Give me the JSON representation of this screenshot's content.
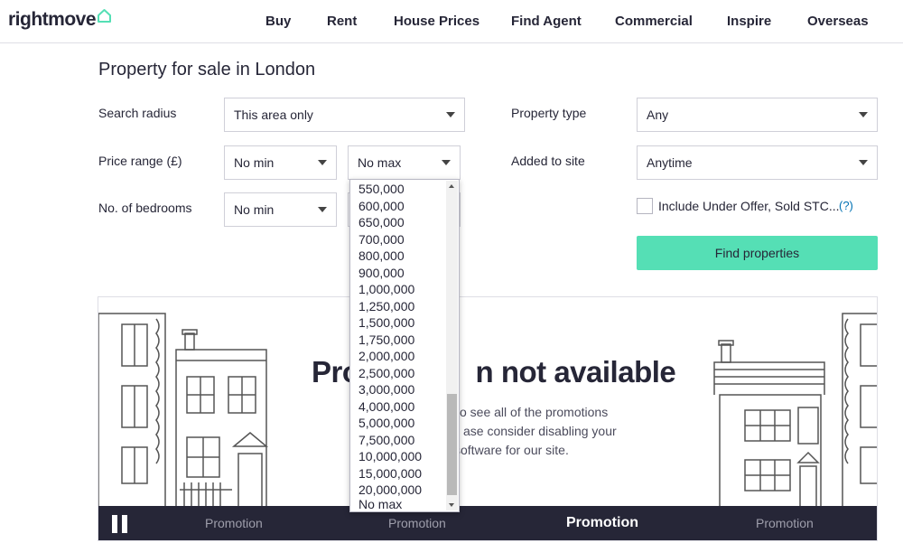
{
  "header": {
    "logo_text": "rightmove",
    "nav": [
      "Buy",
      "Rent",
      "House Prices",
      "Find Agent",
      "Commercial",
      "Inspire",
      "Overseas"
    ]
  },
  "page_title": "Property for sale in London",
  "form": {
    "search_radius": {
      "label": "Search radius",
      "value": "This area only"
    },
    "price_range": {
      "label": "Price range (£)",
      "min": "No min",
      "max": "No max"
    },
    "bedrooms": {
      "label": "No. of bedrooms",
      "min": "No min"
    },
    "property_type": {
      "label": "Property type",
      "value": "Any"
    },
    "added_to_site": {
      "label": "Added to site",
      "value": "Anytime"
    },
    "include_under_offer": {
      "label": "Include Under Offer, Sold STC...",
      "help": "(?)"
    },
    "find_button": "Find properties"
  },
  "max_price_dropdown": {
    "options": [
      "550,000",
      "600,000",
      "650,000",
      "700,000",
      "800,000",
      "900,000",
      "1,000,000",
      "1,250,000",
      "1,500,000",
      "1,750,000",
      "2,000,000",
      "2,500,000",
      "3,000,000",
      "4,000,000",
      "5,000,000",
      "7,500,000",
      "10,000,000",
      "15,000,000",
      "20,000,000",
      "No max"
    ]
  },
  "promo": {
    "title_left": "Pro",
    "title_right": "n not available",
    "message_lines": [
      "o see all of the promotions",
      "ase consider disabling your",
      "software for our site."
    ],
    "tabs": [
      "Promotion",
      "Promotion",
      "Promotion",
      "Promotion"
    ],
    "active_tab": 2
  },
  "colors": {
    "accent": "#55dfb5",
    "text": "#262637",
    "promo_bar": "#262637"
  }
}
